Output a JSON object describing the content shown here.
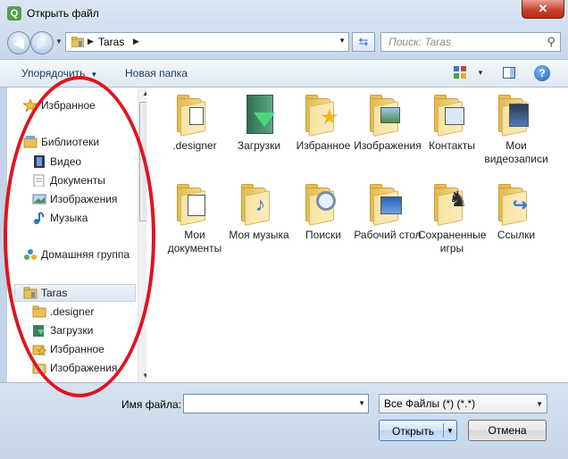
{
  "window": {
    "title": "Открыть файл",
    "app_icon": "qt-creator-icon",
    "close_glyph": "✕"
  },
  "navigation": {
    "back_icon": "back-arrow-icon",
    "forward_icon": "forward-arrow-icon",
    "address_crumb": "Taras",
    "search_placeholder": "Поиск: Taras"
  },
  "toolbar": {
    "organize_label": "Упорядочить",
    "new_folder_label": "Новая папка"
  },
  "nav_pane": {
    "items": [
      {
        "label": "Избранное",
        "icon": "star-icon"
      },
      {
        "label": "Библиотеки",
        "icon": "libraries-icon"
      },
      {
        "label": "Видео",
        "icon": "video-icon"
      },
      {
        "label": "Документы",
        "icon": "documents-icon"
      },
      {
        "label": "Изображения",
        "icon": "pictures-icon"
      },
      {
        "label": "Музыка",
        "icon": "music-icon"
      },
      {
        "label": "Домашняя группа",
        "icon": "homegroup-icon"
      },
      {
        "label": "Taras",
        "icon": "user-folder-icon"
      },
      {
        "label": ".designer",
        "icon": "folder-icon"
      },
      {
        "label": "Загрузки",
        "icon": "downloads-folder-icon"
      },
      {
        "label": "Избранное",
        "icon": "favorites-folder-icon"
      },
      {
        "label": "Изображения",
        "icon": "pictures-folder-icon"
      }
    ],
    "selected": "Taras"
  },
  "files": [
    {
      "label": ".designer",
      "icon": "folder-icon"
    },
    {
      "label": "Загрузки",
      "icon": "downloads-folder-icon"
    },
    {
      "label": "Избранное",
      "icon": "favorites-folder-icon"
    },
    {
      "label": "Изображения",
      "icon": "pictures-folder-icon"
    },
    {
      "label": "Контакты",
      "icon": "contacts-folder-icon"
    },
    {
      "label": "Мои видеозаписи",
      "icon": "videos-folder-icon"
    },
    {
      "label": "Мои документы",
      "icon": "documents-folder-icon"
    },
    {
      "label": "Моя музыка",
      "icon": "music-folder-icon"
    },
    {
      "label": "Поиски",
      "icon": "searches-folder-icon"
    },
    {
      "label": "Рабочий стол",
      "icon": "desktop-folder-icon"
    },
    {
      "label": "Сохраненные игры",
      "icon": "saved-games-folder-icon"
    },
    {
      "label": "Ссылки",
      "icon": "links-folder-icon"
    }
  ],
  "bottom": {
    "filename_label": "Имя файла:",
    "filename_value": "",
    "filter_value": "Все Файлы (*) (*.*)",
    "open_label": "Открыть",
    "cancel_label": "Отмена"
  },
  "colors": {
    "annotation": "#e0141e",
    "accent": "#3d7bc6"
  }
}
